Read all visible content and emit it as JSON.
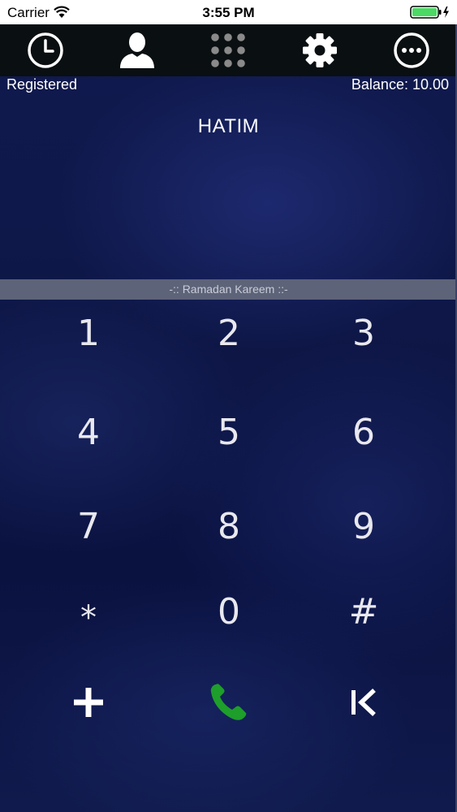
{
  "status_bar": {
    "carrier": "Carrier",
    "time": "3:55 PM"
  },
  "nav": {
    "items": [
      {
        "icon": "clock-icon",
        "name": "history"
      },
      {
        "icon": "person-icon",
        "name": "contacts"
      },
      {
        "icon": "keypad-grid-icon",
        "name": "keypad"
      },
      {
        "icon": "gear-icon",
        "name": "settings"
      },
      {
        "icon": "more-icon",
        "name": "more"
      }
    ]
  },
  "info": {
    "registration_status": "Registered",
    "balance": "Balance: 10.00"
  },
  "caller_name": "HATIM",
  "dial": {
    "number": "",
    "placeholder": ""
  },
  "banner_text": "-:: Ramadan Kareem ::-",
  "keypad": {
    "keys": [
      "1",
      "2",
      "3",
      "4",
      "5",
      "6",
      "7",
      "8",
      "9",
      "*",
      "0",
      "#"
    ]
  },
  "actions": {
    "add_icon": "plus-icon",
    "call_icon": "phone-icon",
    "backspace_icon": "backspace-icon"
  },
  "colors": {
    "background": "#0e1747",
    "nav_bar": "#0a0f12",
    "banner": "#5d6378",
    "call_green": "#1e9e2a",
    "battery_green": "#4cd964"
  }
}
